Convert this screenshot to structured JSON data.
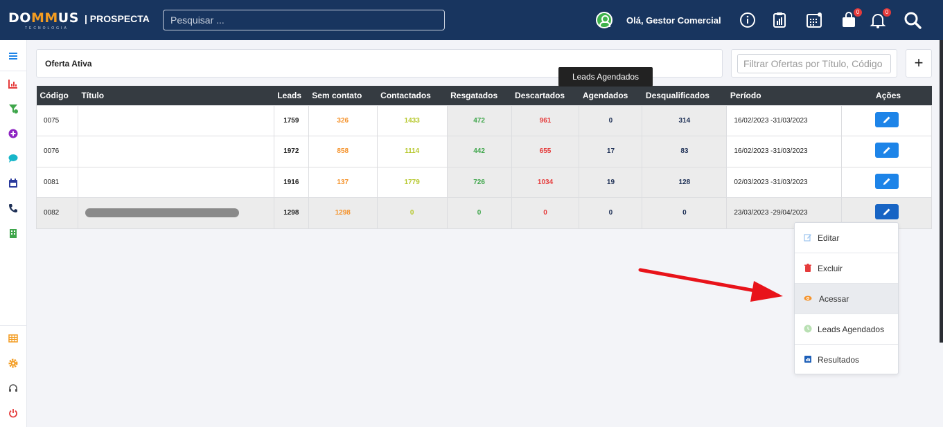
{
  "header": {
    "logo_part1": "DO",
    "logo_accent": "MM",
    "logo_part2": "US",
    "logo_sub": "TECNOLOGIA",
    "product": "| PROSPECTA",
    "search_placeholder": "Pesquisar ...",
    "greeting": "Olá, Gestor Comercial",
    "icons": [
      "info-icon",
      "clipboard-chart-icon",
      "calendar-icon",
      "bag-icon",
      "bell-icon",
      "search-icon"
    ],
    "bag_badge": "0",
    "bell_badge": "0"
  },
  "sidebar": {
    "icons": [
      "menu-icon",
      "chart-icon",
      "funnel-icon",
      "plus-circle-icon",
      "chat-icon",
      "calendar-icon",
      "phone-icon",
      "building-icon"
    ],
    "bottom_icons": [
      "grid-icon",
      "gear-icon",
      "headset-icon",
      "power-icon"
    ]
  },
  "page": {
    "title": "Oferta Ativa",
    "filter_placeholder": "Filtrar Ofertas por Título, Código",
    "add_label": "+",
    "tooltip": "Leads Agendados"
  },
  "table": {
    "headers": [
      "Código",
      "Título",
      "Leads",
      "Sem contato",
      "Contactados",
      "Resgatados",
      "Descartados",
      "Agendados",
      "Desqualificados",
      "Período",
      "Ações"
    ],
    "rows": [
      {
        "codigo": "0075",
        "titulo": "",
        "leads": "1759",
        "sem_contato": "326",
        "contactados": "1433",
        "resgatados": "472",
        "descartados": "961",
        "agendados": "0",
        "desqualificados": "314",
        "periodo": "16/02/2023 -31/03/2023"
      },
      {
        "codigo": "0076",
        "titulo": "",
        "leads": "1972",
        "sem_contato": "858",
        "contactados": "1114",
        "resgatados": "442",
        "descartados": "655",
        "agendados": "17",
        "desqualificados": "83",
        "periodo": "16/02/2023 -31/03/2023"
      },
      {
        "codigo": "0081",
        "titulo": "",
        "leads": "1916",
        "sem_contato": "137",
        "contactados": "1779",
        "resgatados": "726",
        "descartados": "1034",
        "agendados": "19",
        "desqualificados": "128",
        "periodo": "02/03/2023 -31/03/2023"
      },
      {
        "codigo": "0082",
        "titulo": "",
        "leads": "1298",
        "sem_contato": "1298",
        "contactados": "0",
        "resgatados": "0",
        "descartados": "0",
        "agendados": "0",
        "desqualificados": "0",
        "periodo": "23/03/2023 -29/04/2023"
      }
    ]
  },
  "dropdown": {
    "items": [
      "Editar",
      "Excluir",
      "Acessar",
      "Leads Agendados",
      "Resultados"
    ]
  },
  "colors": {
    "header_bg": "#18355f",
    "accent_orange": "#f39c21",
    "edit_blue": "#1d84e8",
    "arrow_red": "#e8131a"
  }
}
